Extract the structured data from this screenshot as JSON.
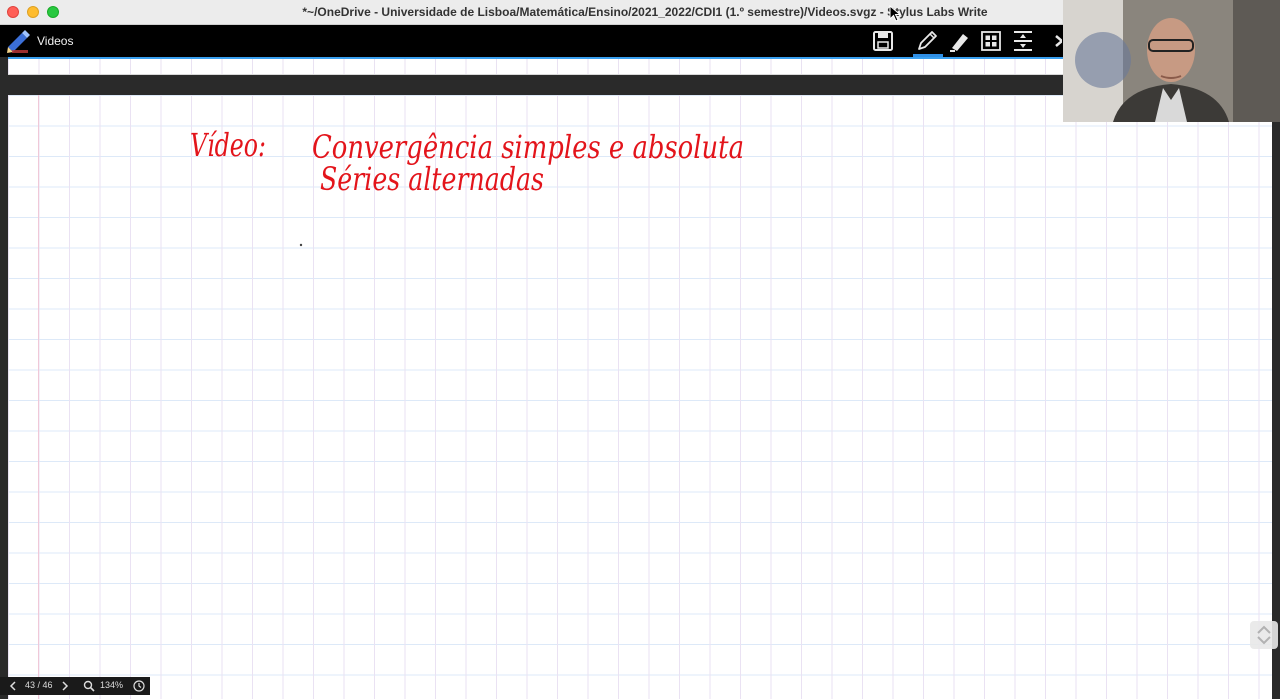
{
  "window": {
    "title": "*~/OneDrive - Universidade de Lisboa/Matemática/Ensino/2021_2022/CDI1 (1.º semestre)/Videos.svgz - Stylus Labs Write"
  },
  "toolbar": {
    "document_name": "Videos",
    "buttons": [
      {
        "name": "save",
        "icon": "floppy-disk-icon"
      },
      {
        "name": "pen",
        "icon": "pen-icon",
        "active": true
      },
      {
        "name": "eraser",
        "icon": "eraser-icon"
      },
      {
        "name": "select",
        "icon": "grid-select-icon"
      },
      {
        "name": "insert-space",
        "icon": "insert-space-icon"
      }
    ],
    "accent_color": "#2f8fe5"
  },
  "page": {
    "handwriting": {
      "line1_label": "Vídeo:",
      "line1_text": "Convergência simples e absoluta",
      "line2_text": "Séries alternadas",
      "ink_color": "#e3141b"
    }
  },
  "statusbar": {
    "page_indicator": "43 / 46",
    "zoom": "134%"
  }
}
